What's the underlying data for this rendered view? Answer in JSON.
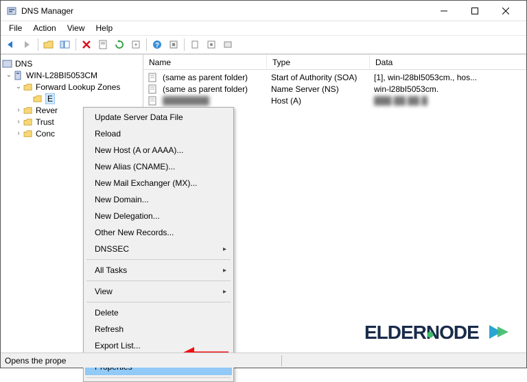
{
  "window": {
    "title": "DNS Manager"
  },
  "menubar": {
    "items": [
      "File",
      "Action",
      "View",
      "Help"
    ]
  },
  "tree": {
    "root": "DNS",
    "server": "WIN-L28BI5053CM",
    "zones_label": "Forward Lookup Zones",
    "selected_prefix": "E",
    "items": [
      "Rever",
      "Trust",
      "Conc"
    ]
  },
  "columns": {
    "name": "Name",
    "type": "Type",
    "data": "Data"
  },
  "records": [
    {
      "name": "(same as parent folder)",
      "type": "Start of Authority (SOA)",
      "data": "[1], win-l28bI5053cm., hos..."
    },
    {
      "name": "(same as parent folder)",
      "type": "Name Server (NS)",
      "data": "win-l28bI5053cm."
    },
    {
      "name": "",
      "type": "Host (A)",
      "data": ""
    }
  ],
  "context_menu": {
    "items": [
      {
        "label": "Update Server Data File",
        "type": "item"
      },
      {
        "label": "Reload",
        "type": "item"
      },
      {
        "label": "New Host (A or AAAA)...",
        "type": "item"
      },
      {
        "label": "New Alias (CNAME)...",
        "type": "item"
      },
      {
        "label": "New Mail Exchanger (MX)...",
        "type": "item"
      },
      {
        "label": "New Domain...",
        "type": "item"
      },
      {
        "label": "New Delegation...",
        "type": "item"
      },
      {
        "label": "Other New Records...",
        "type": "item"
      },
      {
        "label": "DNSSEC",
        "type": "submenu"
      },
      {
        "type": "sep"
      },
      {
        "label": "All Tasks",
        "type": "submenu"
      },
      {
        "type": "sep"
      },
      {
        "label": "View",
        "type": "submenu"
      },
      {
        "type": "sep"
      },
      {
        "label": "Delete",
        "type": "item"
      },
      {
        "label": "Refresh",
        "type": "item"
      },
      {
        "label": "Export List...",
        "type": "item"
      },
      {
        "type": "sep"
      },
      {
        "label": "Properties",
        "type": "item",
        "highlighted": true
      },
      {
        "type": "sep"
      }
    ]
  },
  "statusbar": {
    "text": "Opens the prope"
  },
  "logo": {
    "text": "ELDERNODE"
  }
}
